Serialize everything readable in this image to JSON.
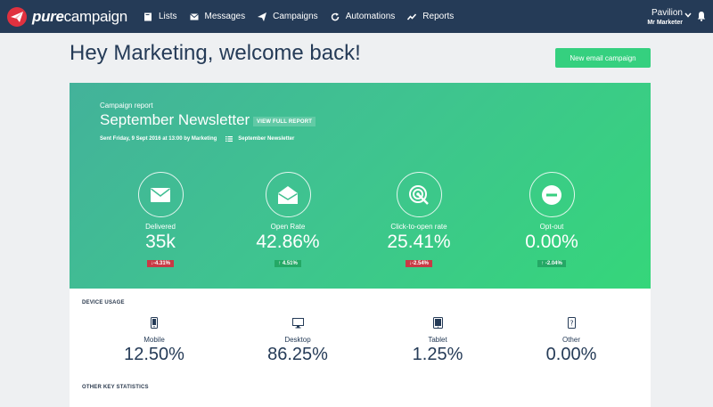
{
  "brand": {
    "bold": "pure",
    "light": "campaign"
  },
  "nav": [
    {
      "label": "Lists",
      "icon": "book-icon"
    },
    {
      "label": "Messages",
      "icon": "envelope-icon"
    },
    {
      "label": "Campaigns",
      "icon": "paper-plane-icon"
    },
    {
      "label": "Automations",
      "icon": "refresh-icon"
    },
    {
      "label": "Reports",
      "icon": "chart-line-icon"
    }
  ],
  "user": {
    "org": "Pavilion",
    "role": "Mr Marketer"
  },
  "page": {
    "welcome": "Hey Marketing, welcome back!",
    "new_campaign": "New email campaign"
  },
  "report": {
    "kicker": "Campaign report",
    "title": "September Newsletter",
    "view_full": "VIEW FULL REPORT",
    "sent": "Sent Friday, 9 Sept 2016 at 13:00 by Marketing",
    "list_name": "September Newsletter",
    "metrics": [
      {
        "label": "Delivered",
        "value": "35k",
        "delta": "↓-4.31%",
        "trend": "down",
        "icon": "envelope-icon"
      },
      {
        "label": "Open Rate",
        "value": "42.86%",
        "delta": "↑ 4.51%",
        "trend": "up",
        "icon": "envelope-open-icon"
      },
      {
        "label": "Click-to-open rate",
        "value": "25.41%",
        "delta": "↓-2.54%",
        "trend": "down",
        "icon": "target-click-icon"
      },
      {
        "label": "Opt-out",
        "value": "0.00%",
        "delta": "↑ -2.04%",
        "trend": "up",
        "icon": "minus-circle-icon"
      }
    ]
  },
  "devices": {
    "title": "DEVICE USAGE",
    "items": [
      {
        "label": "Mobile",
        "value": "12.50%",
        "icon": "mobile-icon"
      },
      {
        "label": "Desktop",
        "value": "86.25%",
        "icon": "desktop-icon"
      },
      {
        "label": "Tablet",
        "value": "1.25%",
        "icon": "tablet-icon"
      },
      {
        "label": "Other",
        "value": "0.00%",
        "icon": "device-other-icon"
      }
    ]
  },
  "other_stats": {
    "title": "OTHER KEY STATISTICS"
  },
  "colors": {
    "nav": "#253b57",
    "accent": "#35d07f",
    "down": "#c83a45",
    "up": "#24a865",
    "brand_red": "#e0313f"
  }
}
